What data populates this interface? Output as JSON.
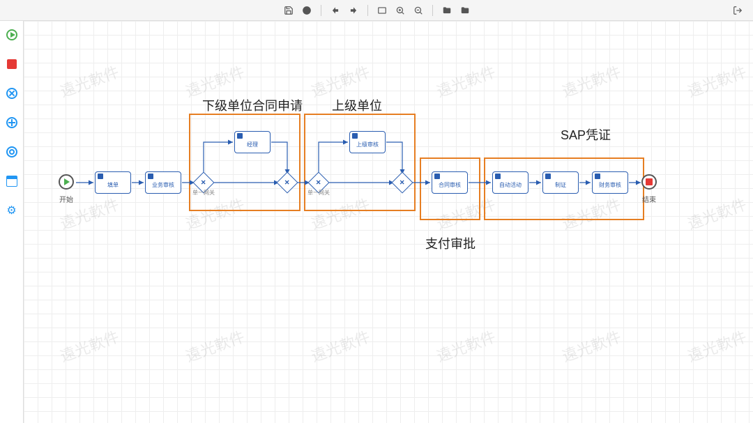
{
  "toolbar": {
    "save": "保存",
    "validate": "校验",
    "undo": "撤销",
    "redo": "重做",
    "fit": "适应",
    "zoom_in": "放大",
    "zoom_out": "缩小",
    "folder_a": "导入",
    "folder_b": "导出",
    "exit": "退出"
  },
  "palette": {
    "start": "开始事件",
    "end": "结束事件",
    "cancel": "取消",
    "plus": "添加",
    "intermediate": "中间事件",
    "form": "表单",
    "settings": "设置"
  },
  "nodes": {
    "start": {
      "label": "开始"
    },
    "fill": {
      "label": "填单"
    },
    "biz_review": {
      "label": "业务审核"
    },
    "gw1": {
      "label": "单一网关"
    },
    "manager": {
      "label": "经理"
    },
    "gw2": {
      "label": ""
    },
    "gw3": {
      "label": "单一网关"
    },
    "superior": {
      "label": "上级审核"
    },
    "gw4": {
      "label": ""
    },
    "contract_review": {
      "label": "合同审核"
    },
    "auto": {
      "label": "自动活动"
    },
    "voucher": {
      "label": "制证"
    },
    "finance_review": {
      "label": "财务审核"
    },
    "end": {
      "label": "结束"
    }
  },
  "annotations": {
    "a1": "下级单位合同申请",
    "a2": "上级单位",
    "a3": "支付审批",
    "a4": "SAP凭证"
  },
  "watermark": "遠光軟件"
}
